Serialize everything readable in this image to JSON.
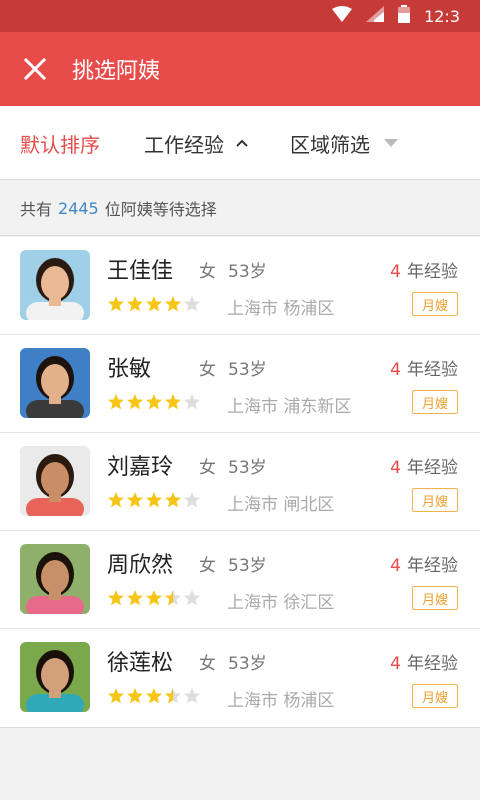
{
  "status_bar": {
    "time": "12:3"
  },
  "app_bar": {
    "title": "挑选阿姨",
    "close_icon": "close-icon"
  },
  "filters": {
    "sort_label": "默认排序",
    "experience_label": "工作经验",
    "area_label": "区域筛选"
  },
  "summary": {
    "prefix": "共有",
    "count": "2445",
    "suffix": "位阿姨等待选择"
  },
  "colors": {
    "primary": "#e84c4a",
    "status_bar": "#c63a38",
    "star": "#f5c518",
    "badge": "#f0a030",
    "count": "#3f88c5"
  },
  "caregivers": [
    {
      "name": "王佳佳",
      "gender": "女",
      "age": "53岁",
      "rating": 4,
      "location": "上海市 杨浦区",
      "exp_years": "4",
      "exp_label": "年经验",
      "badge": "月嫂"
    },
    {
      "name": "张敏",
      "gender": "女",
      "age": "53岁",
      "rating": 4,
      "location": "上海市 浦东新区",
      "exp_years": "4",
      "exp_label": "年经验",
      "badge": "月嫂"
    },
    {
      "name": "刘嘉玲",
      "gender": "女",
      "age": "53岁",
      "rating": 4,
      "location": "上海市 闸北区",
      "exp_years": "4",
      "exp_label": "年经验",
      "badge": "月嫂"
    },
    {
      "name": "周欣然",
      "gender": "女",
      "age": "53岁",
      "rating": 3.5,
      "location": "上海市 徐汇区",
      "exp_years": "4",
      "exp_label": "年经验",
      "badge": "月嫂"
    },
    {
      "name": "徐莲松",
      "gender": "女",
      "age": "53岁",
      "rating": 3.5,
      "location": "上海市 杨浦区",
      "exp_years": "4",
      "exp_label": "年经验",
      "badge": "月嫂"
    }
  ]
}
